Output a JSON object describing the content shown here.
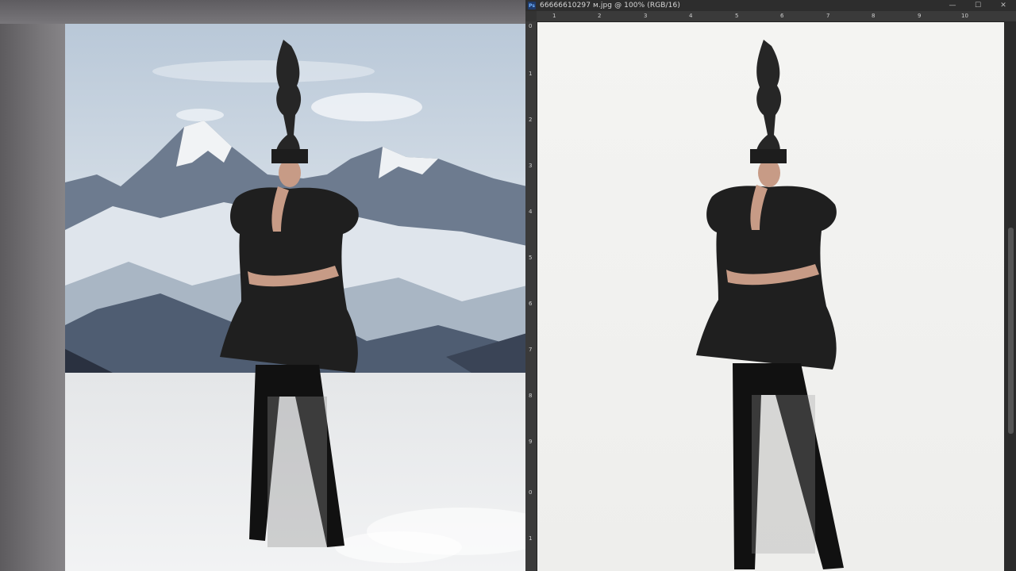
{
  "ps_window": {
    "app_icon": "Ps",
    "title": "66666610297 м.jpg @ 100% (RGB/16)",
    "controls": {
      "minimize": "—",
      "maximize": "☐",
      "close": "✕"
    }
  },
  "rulers": {
    "top_ticks": [
      "1",
      "2",
      "3",
      "4",
      "5",
      "6",
      "7",
      "8",
      "9",
      "10"
    ],
    "left_ticks": [
      "0",
      "1",
      "2",
      "3",
      "4",
      "5",
      "6",
      "7",
      "8",
      "9",
      "0",
      "1"
    ]
  },
  "left_document": {
    "scene": "mountain-snow-composite"
  },
  "colors": {
    "sky": "#c9d6e2",
    "mountain": "#5d6b80",
    "snow": "#eef1f4",
    "dress": "#1e1e1e",
    "canvas": "#f1f1ef"
  }
}
